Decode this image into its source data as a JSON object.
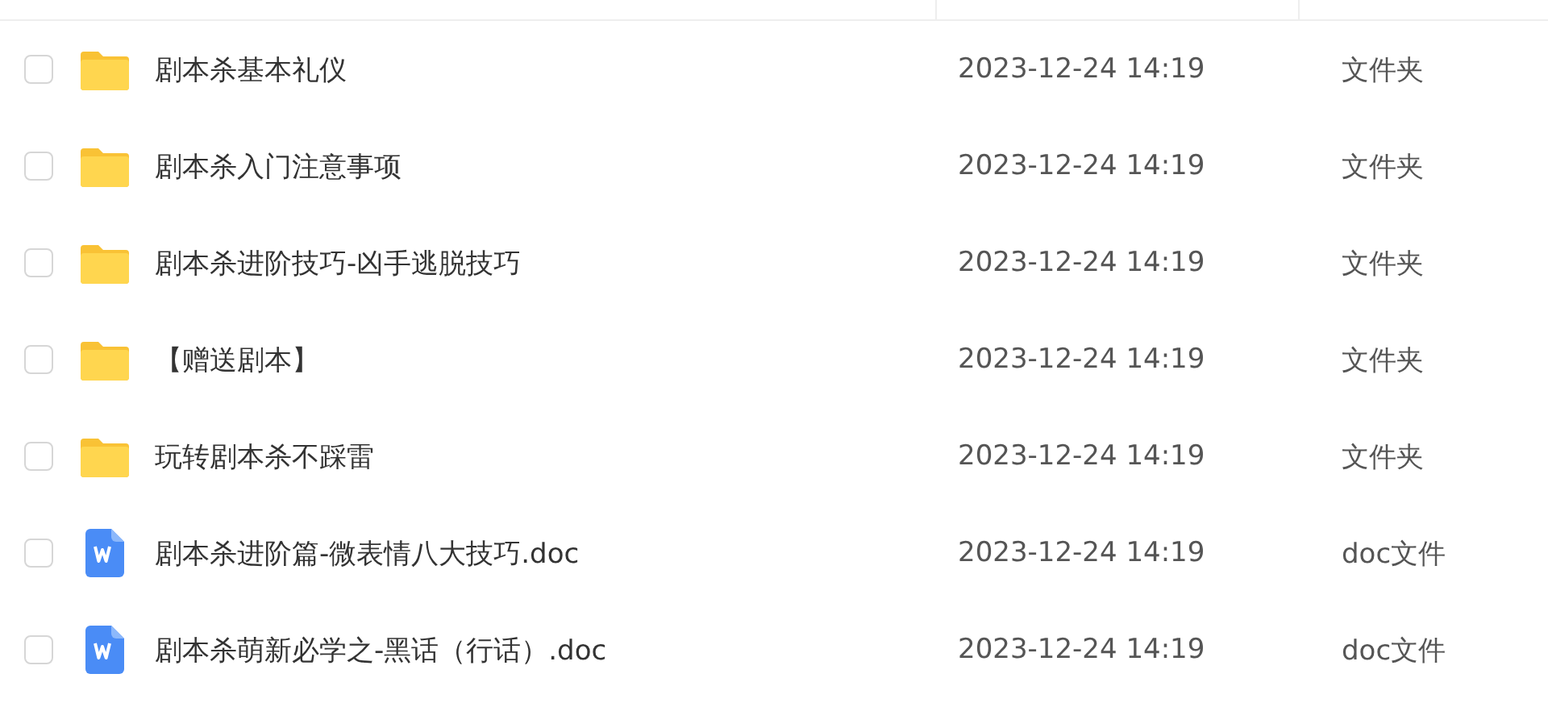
{
  "files": [
    {
      "kind": "folder",
      "name": "剧本杀基本礼仪",
      "modified": "2023-12-24 14:19",
      "type": "文件夹",
      "checked": false
    },
    {
      "kind": "folder",
      "name": "剧本杀入门注意事项",
      "modified": "2023-12-24 14:19",
      "type": "文件夹",
      "checked": false
    },
    {
      "kind": "folder",
      "name": "剧本杀进阶技巧-凶手逃脱技巧",
      "modified": "2023-12-24 14:19",
      "type": "文件夹",
      "checked": false
    },
    {
      "kind": "folder",
      "name": "【赠送剧本】",
      "modified": "2023-12-24 14:19",
      "type": "文件夹",
      "checked": false
    },
    {
      "kind": "folder",
      "name": "玩转剧本杀不踩雷",
      "modified": "2023-12-24 14:19",
      "type": "文件夹",
      "checked": false
    },
    {
      "kind": "doc",
      "name": "剧本杀进阶篇-微表情八大技巧.doc",
      "modified": "2023-12-24 14:19",
      "type": "doc文件",
      "checked": false
    },
    {
      "kind": "doc",
      "name": "剧本杀萌新必学之-黑话（行话）.doc",
      "modified": "2023-12-24 14:19",
      "type": "doc文件",
      "checked": false
    }
  ]
}
